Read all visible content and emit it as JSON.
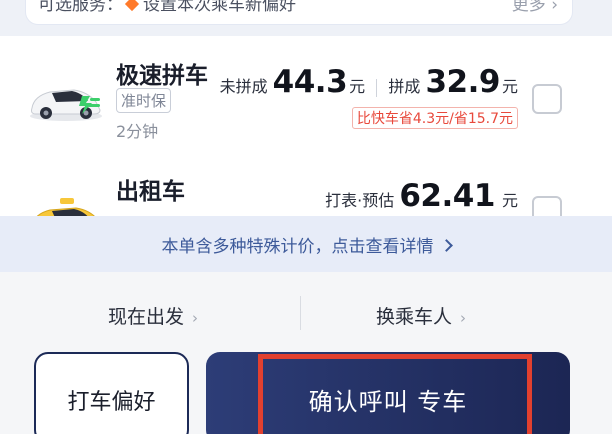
{
  "banner": {
    "prefix": "可选服务：",
    "text": "设置本次乘车新偏好",
    "more": "更多 ›"
  },
  "options": [
    {
      "name": "极速拼车",
      "tag": "准时保",
      "eta": "2分钟",
      "price1_label": "未拼成",
      "price1": "44.3",
      "price2_label": "拼成",
      "price2": "32.9",
      "unit": "元",
      "save_prefix": "比快车",
      "save_detail": "省4.3元/省15.7元",
      "checked": false
    },
    {
      "name": "出租车",
      "price_label": "打表·预估",
      "price": "62.41",
      "unit": "元",
      "checked": false
    }
  ],
  "notice": {
    "text": "本单含多种特殊计价，点击查看详情"
  },
  "bottom": {
    "depart": "现在出发",
    "rider": "换乘车人",
    "pref_button": "打车偏好",
    "confirm_button": "确认呼叫 专车"
  },
  "colors": {
    "brand_dark": "#1c2654",
    "accent_red": "#e2402f",
    "notice_blue": "#3d5a9a"
  },
  "icons": {
    "diamond": "orange-diamond-icon",
    "chevron": "chevron-right-icon"
  }
}
